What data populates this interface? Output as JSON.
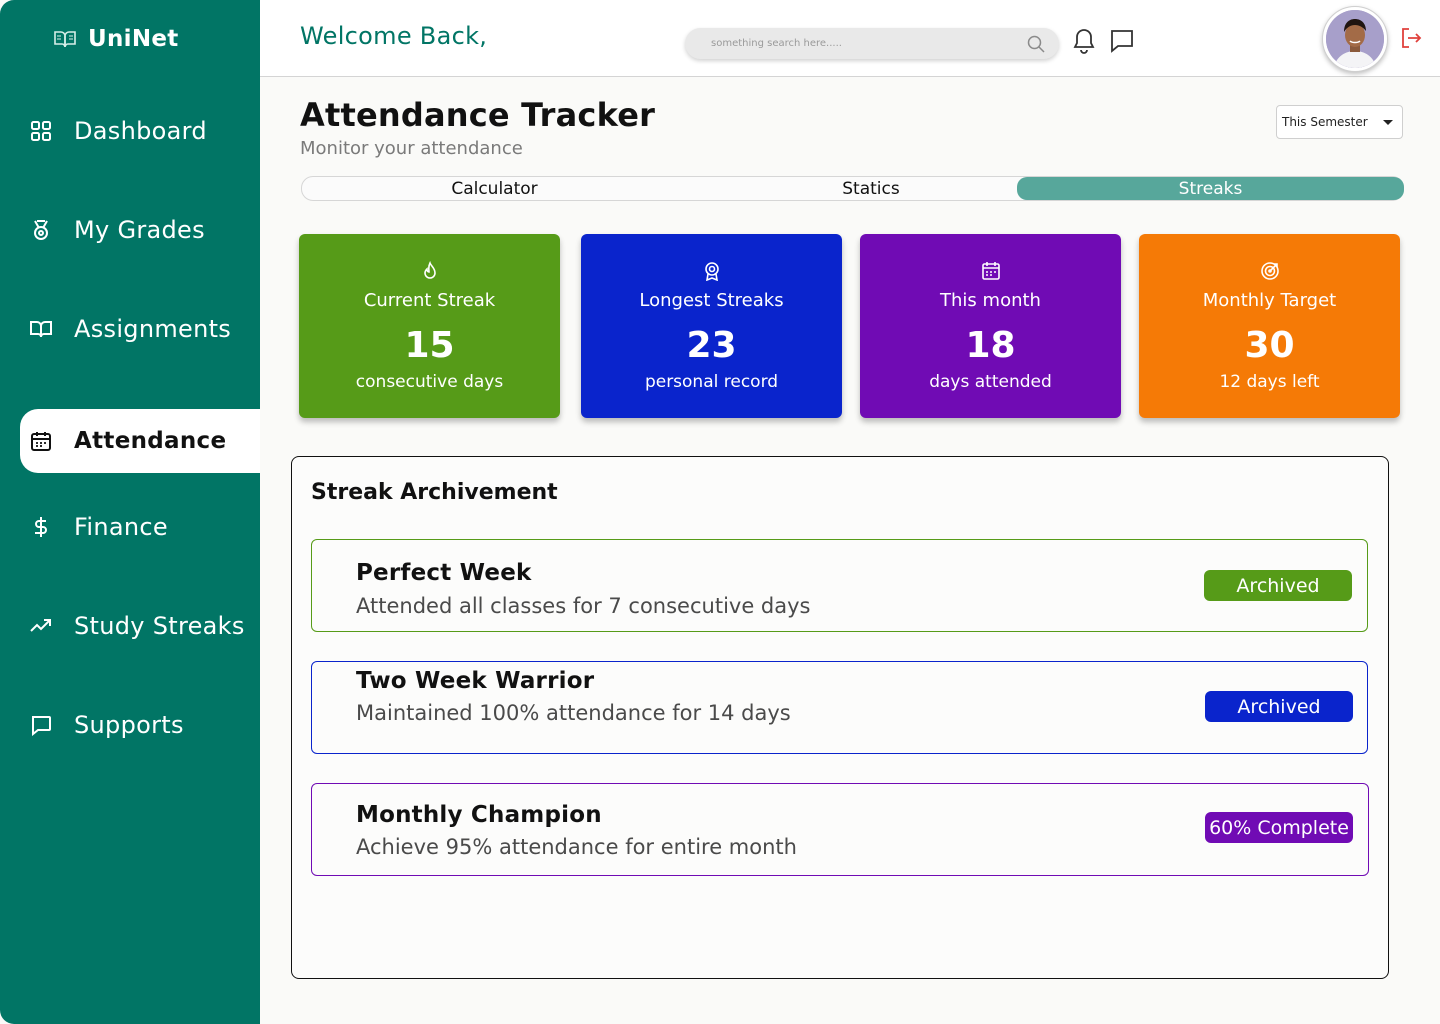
{
  "app": {
    "brand": "UniNet"
  },
  "sidebar": {
    "items": [
      {
        "label": "Dashboard",
        "icon": "grid-icon"
      },
      {
        "label": "My Grades",
        "icon": "medal-icon"
      },
      {
        "label": "Assignments",
        "icon": "book-icon"
      },
      {
        "label": "Attendance",
        "icon": "calendar-icon",
        "active": true
      },
      {
        "label": "Finance",
        "icon": "dollar-icon"
      },
      {
        "label": "Study Streaks",
        "icon": "trend-up-icon"
      },
      {
        "label": "Supports",
        "icon": "chat-icon"
      }
    ]
  },
  "header": {
    "welcome": "Welcome Back,",
    "search_placeholder": "something search here.....",
    "icons": [
      "search-icon",
      "bell-icon",
      "message-icon",
      "logout-icon"
    ]
  },
  "page": {
    "title": "Attendance Tracker",
    "subtitle": "Monitor your attendance",
    "period": "This Semester"
  },
  "tabs": [
    {
      "label": "Calculator"
    },
    {
      "label": "Statics"
    },
    {
      "label": "Streaks",
      "active": true
    }
  ],
  "stats": [
    {
      "title": "Current Streak",
      "value": "15",
      "caption": "consecutive days",
      "color": "#569b18",
      "icon": "flame-icon"
    },
    {
      "title": "Longest Streaks",
      "value": "23",
      "caption": "personal record",
      "color": "#0a24cc",
      "icon": "award-icon"
    },
    {
      "title": "This month",
      "value": "18",
      "caption": "days attended",
      "color": "#700bb4",
      "icon": "calendar-icon"
    },
    {
      "title": "Monthly Target",
      "value": "30",
      "caption": "12 days left",
      "color": "#f57a06",
      "icon": "target-icon"
    }
  ],
  "achievements": {
    "title": "Streak Archivement",
    "items": [
      {
        "title": "Perfect Week",
        "description": "Attended all classes for 7 consecutive days",
        "status": "Archived",
        "color": "#569b18"
      },
      {
        "title": "Two Week Warrior",
        "description": "Maintained 100% attendance for 14 days",
        "status": "Archived",
        "color": "#0a24cc"
      },
      {
        "title": "Monthly Champion",
        "description": "Achieve 95% attendance for entire month",
        "status": "60% Complete",
        "color": "#700bb4"
      }
    ]
  },
  "colors": {
    "primary": "#017565",
    "tab_active": "#57a79b",
    "logout": "#e0413c"
  }
}
